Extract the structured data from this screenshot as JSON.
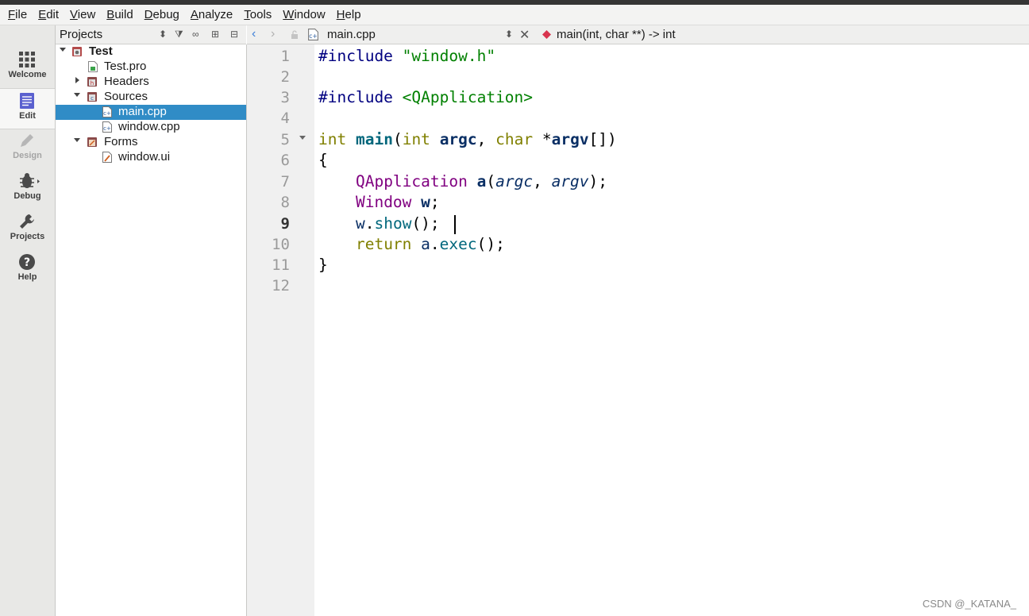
{
  "menubar": {
    "items": [
      {
        "accel": "F",
        "rest": "ile"
      },
      {
        "accel": "E",
        "rest": "dit"
      },
      {
        "accel": "V",
        "rest": "iew"
      },
      {
        "accel": "B",
        "rest": "uild"
      },
      {
        "accel": "D",
        "rest": "ebug"
      },
      {
        "accel": "A",
        "rest": "nalyze"
      },
      {
        "accel": "T",
        "rest": "ools"
      },
      {
        "accel": "W",
        "rest": "indow"
      },
      {
        "accel": "H",
        "rest": "elp"
      }
    ]
  },
  "modebar": {
    "welcome": "Welcome",
    "edit": "Edit",
    "design": "Design",
    "debug": "Debug",
    "projects": "Projects",
    "help": "Help"
  },
  "projects_pane": {
    "title": "Projects",
    "tree": {
      "root": "Test",
      "pro_file": "Test.pro",
      "headers": "Headers",
      "sources": "Sources",
      "main_cpp": "main.cpp",
      "window_cpp": "window.cpp",
      "forms": "Forms",
      "window_ui": "window.ui"
    }
  },
  "editor_header": {
    "file": "main.cpp",
    "symbol": "main(int, char **) -> int"
  },
  "line_numbers": [
    "1",
    "2",
    "3",
    "4",
    "5",
    "6",
    "7",
    "8",
    "9",
    "10",
    "11",
    "12"
  ],
  "current_line": "9",
  "code": {
    "l1": {
      "directive": "#include",
      "sp": " ",
      "header": "\"window.h\""
    },
    "l3": {
      "directive": "#include",
      "sp": " ",
      "header": "<QApplication>"
    },
    "l5": {
      "t1": "int",
      "s1": " ",
      "name": "main",
      "p1": "(",
      "t2": "int",
      "s2": " ",
      "a1": "argc",
      "c1": ", ",
      "t3": "char",
      "s3": " *",
      "a2": "argv",
      "p2": "[])"
    },
    "l6": {
      "text": "{"
    },
    "l7": {
      "ind": "    ",
      "type": "QApplication",
      "s": " ",
      "obj": "a",
      "p1": "(",
      "a1": "argc",
      "c": ", ",
      "a2": "argv",
      "p2": ");"
    },
    "l8": {
      "ind": "    ",
      "type": "Window",
      "s": " ",
      "obj": "w",
      "end": ";"
    },
    "l9": {
      "ind": "    ",
      "obj": "w",
      "dot": ".",
      "fn": "show",
      "end": "();"
    },
    "l10": {
      "ind": "    ",
      "kw": "return",
      "s": " ",
      "obj": "a",
      "dot": ".",
      "fn": "exec",
      "end": "();"
    },
    "l11": {
      "text": "}"
    }
  },
  "watermark": "CSDN @_KATANA_"
}
